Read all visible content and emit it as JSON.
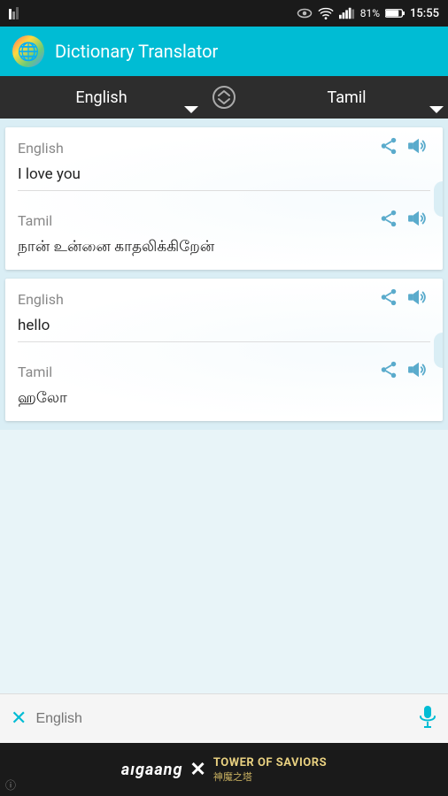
{
  "statusBar": {
    "battery": "81%",
    "time": "15:55"
  },
  "header": {
    "title": "Dictionary Translator",
    "flagEmoji": "🌐"
  },
  "langBar": {
    "sourceLanguage": "English",
    "targetLanguage": "Tamil",
    "swapLabel": "swap"
  },
  "cards": [
    {
      "sourceLang": "English",
      "sourceText": "I love you",
      "targetLang": "Tamil",
      "targetText": "நான் உன்னை காதலிக்கிறேன்"
    },
    {
      "sourceLang": "English",
      "sourceText": "hello",
      "targetLang": "Tamil",
      "targetText": "ஹலோ"
    }
  ],
  "bottomBar": {
    "placeholder": "English",
    "clearIcon": "✕",
    "micIcon": "🎤"
  },
  "ad": {
    "text1": "aıgaang",
    "separator": "✕",
    "text2": "TOWER OF SAVIORS",
    "text3": "神魔之塔",
    "info": "ⓘ"
  }
}
